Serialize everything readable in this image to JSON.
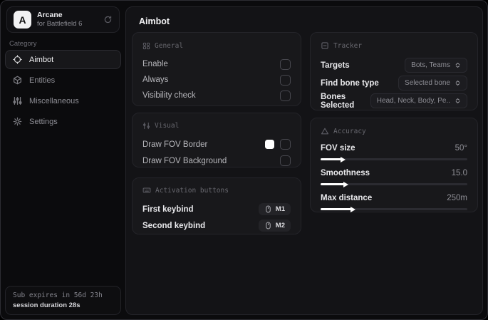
{
  "sidebar": {
    "logo_letter": "A",
    "app_name": "Arcane",
    "app_subtitle": "for Battlefield 6",
    "category_label": "Category",
    "items": [
      {
        "label": "Aimbot"
      },
      {
        "label": "Entities"
      },
      {
        "label": "Miscellaneous"
      },
      {
        "label": "Settings"
      }
    ],
    "status": {
      "expiry": "Sub expires in 56d 23h",
      "session": "session duration 28s"
    }
  },
  "main": {
    "title": "Aimbot",
    "general": {
      "title": "General",
      "rows": [
        {
          "label": "Enable",
          "checked": false
        },
        {
          "label": "Always",
          "checked": false
        },
        {
          "label": "Visibility check",
          "checked": false
        }
      ]
    },
    "visual": {
      "title": "Visual",
      "rows": [
        {
          "label": "Draw FOV Border",
          "swatch_color": "#ffffff",
          "checked": false
        },
        {
          "label": "Draw FOV Background",
          "checked": false
        }
      ]
    },
    "activation": {
      "title": "Activation buttons",
      "rows": [
        {
          "label": "First keybind",
          "key": "M1"
        },
        {
          "label": "Second keybind",
          "key": "M2"
        }
      ]
    },
    "tracker": {
      "title": "Tracker",
      "rows": [
        {
          "label": "Targets",
          "value": "Bots, Teams"
        },
        {
          "label": "Find bone type",
          "value": "Selected bone"
        },
        {
          "label": "Bones Selected",
          "value": "Head, Neck, Body, Pe.."
        }
      ]
    },
    "accuracy": {
      "title": "Accuracy",
      "rows": [
        {
          "label": "FOV size",
          "value": "50°",
          "fill_pct": 14
        },
        {
          "label": "Smoothness",
          "value": "15.0",
          "fill_pct": 16
        },
        {
          "label": "Max distance",
          "value": "250m",
          "fill_pct": 21
        }
      ]
    }
  },
  "colors": {
    "panel_bg": "#131316",
    "card_bg": "#18181b",
    "accent_swatch": "#ffffff"
  }
}
